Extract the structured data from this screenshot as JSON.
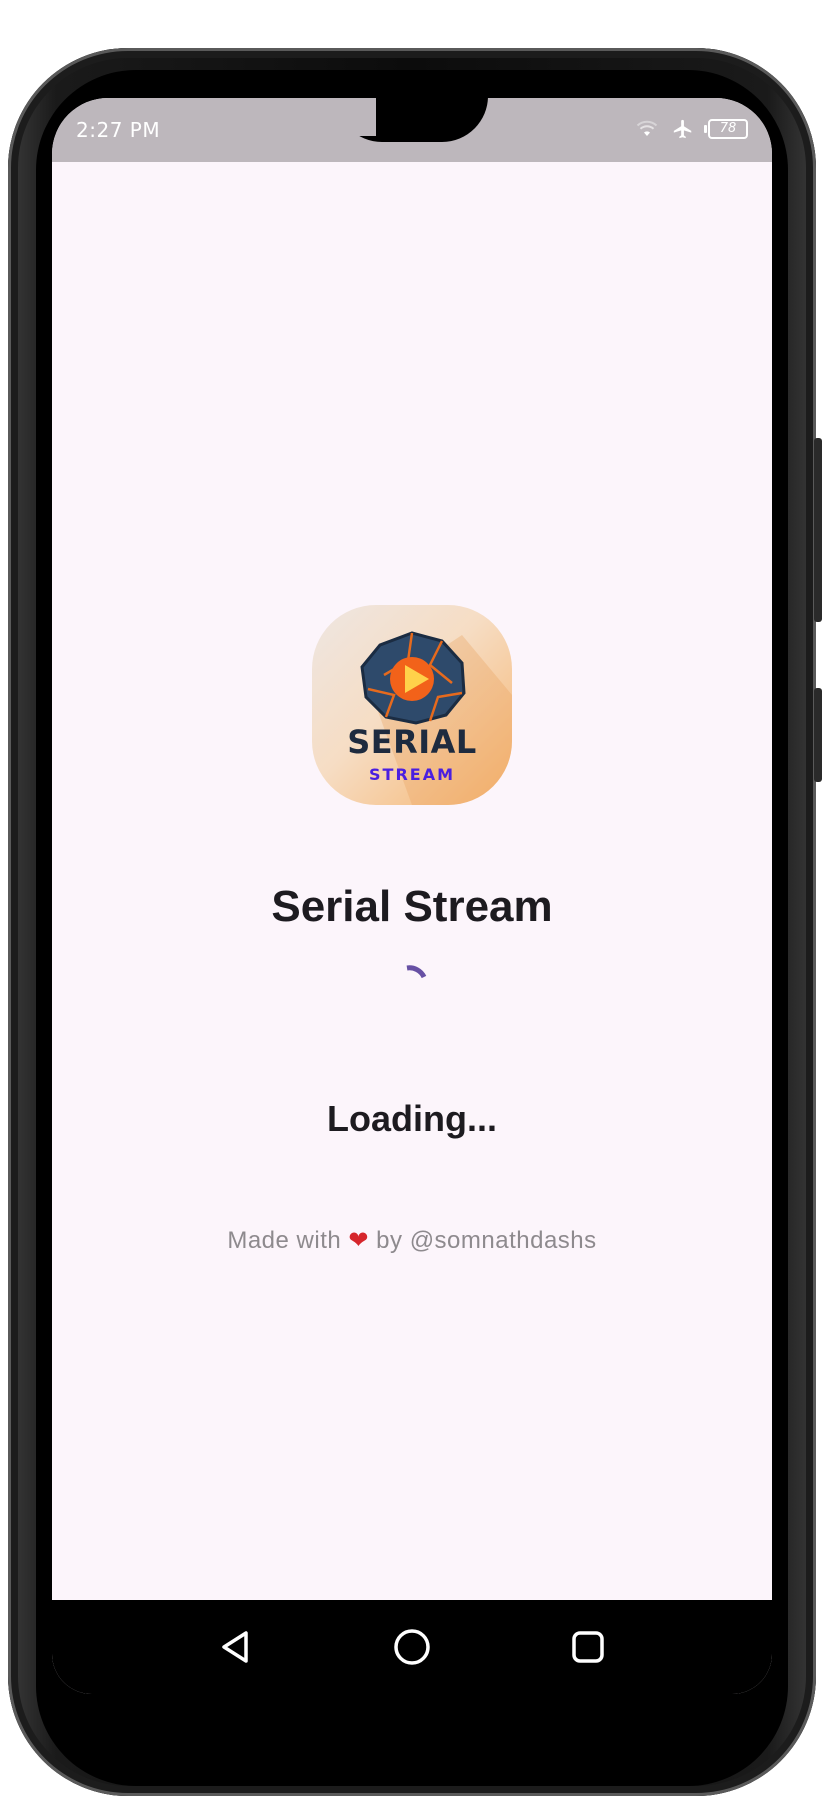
{
  "status_bar": {
    "time": "2:27 PM",
    "battery_level": "78",
    "icons": [
      "wifi-icon",
      "airplane-icon",
      "battery-icon"
    ]
  },
  "app": {
    "title": "Serial Stream",
    "logo_text_primary": "SERIAL",
    "logo_text_secondary": "STREAM"
  },
  "loading": {
    "label": "Loading..."
  },
  "credit": {
    "prefix": "Made with",
    "icon": "heart-icon",
    "suffix": "by @somnathdashs"
  },
  "nav_bar": {
    "buttons": [
      "back-icon",
      "home-icon",
      "recents-icon"
    ]
  },
  "colors": {
    "background": "#fcf5fb",
    "accent": "#6750a4",
    "status_bar": "#bdb7bc",
    "heart": "#d6262c"
  }
}
